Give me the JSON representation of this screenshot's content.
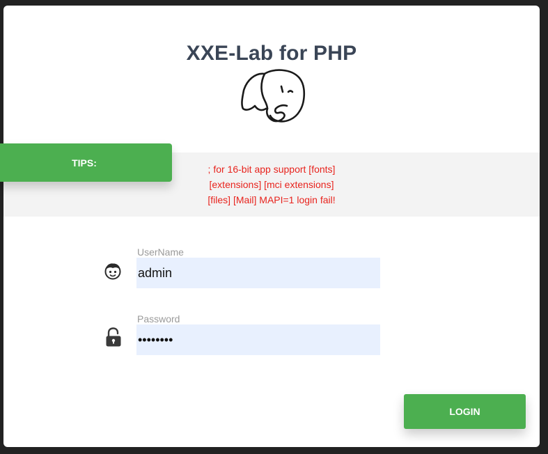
{
  "app": {
    "title": "XXE-Lab for PHP",
    "logo_icon": "php-elephant-icon"
  },
  "tips": {
    "label": "TIPS:",
    "lines": [
      "; for 16-bit app support [fonts]",
      "[extensions] [mci extensions]",
      "[files] [Mail] MAPI=1 login fail!"
    ]
  },
  "form": {
    "username": {
      "label": "UserName",
      "value": "admin",
      "icon": "user-face-icon"
    },
    "password": {
      "label": "Password",
      "value": "password",
      "icon": "unlock-icon"
    },
    "login_label": "LOGIN"
  },
  "colors": {
    "accent": "#4caf50",
    "tips_text": "#e8231d",
    "title": "#3a4556",
    "input_bg": "#e8f0fe"
  }
}
